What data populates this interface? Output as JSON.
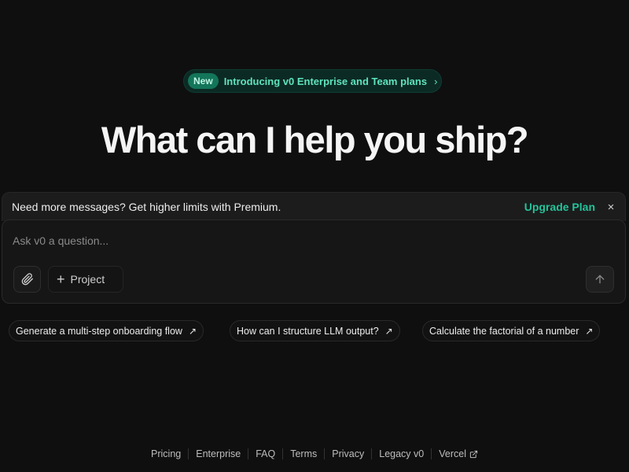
{
  "announcement": {
    "badge": "New",
    "text": "Introducing v0 Enterprise and Team plans",
    "chevron": "›"
  },
  "hero": {
    "title": "What can I help you ship?"
  },
  "banner": {
    "message": "Need more messages? Get higher limits with Premium.",
    "upgrade_label": "Upgrade Plan",
    "close_glyph": "×"
  },
  "composer": {
    "placeholder": "Ask v0 a question...",
    "value": "",
    "project_label": "Project",
    "project_plus": "+"
  },
  "suggestions": [
    {
      "label": "Generate a multi-step onboarding flow",
      "arrow": "↗"
    },
    {
      "label": "How can I structure LLM output?",
      "arrow": "↗"
    },
    {
      "label": "Calculate the factorial of a number",
      "arrow": "↗"
    }
  ],
  "footer": {
    "links": [
      "Pricing",
      "Enterprise",
      "FAQ",
      "Terms",
      "Privacy",
      "Legacy v0",
      "Vercel"
    ]
  },
  "icons": {
    "attach": "paperclip-icon",
    "send": "arrow-up-icon",
    "external": "external-link-icon"
  },
  "colors": {
    "background": "#0f0f0f",
    "accent": "#22c39a",
    "announcement_text": "#5fe3bd",
    "badge_bg": "#137559"
  }
}
